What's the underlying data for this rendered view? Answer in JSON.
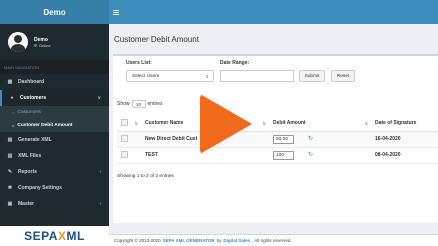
{
  "brand": {
    "title": "Demo"
  },
  "user": {
    "name": "Demo",
    "status": "Online"
  },
  "sidebar": {
    "header": "MAIN NAVIGATION",
    "items": [
      {
        "label": "Dashboard",
        "icon": "dashboard-icon"
      },
      {
        "label": "Customers",
        "icon": "users-icon"
      },
      {
        "label": "Generate XML",
        "icon": "file-icon"
      },
      {
        "label": "XML Files",
        "icon": "files-icon"
      },
      {
        "label": "Reports",
        "icon": "reports-icon"
      },
      {
        "label": "Company Settings",
        "icon": "settings-icon"
      },
      {
        "label": "Master",
        "icon": "master-icon"
      }
    ],
    "subitems": [
      {
        "label": "Customers"
      },
      {
        "label": "Customer Debit Amount"
      }
    ],
    "logo_left": "SEPA",
    "logo_x": "X",
    "logo_right": "ML"
  },
  "main": {
    "title": "Customer Debit Amount",
    "filters": {
      "users_label": "Users List:",
      "users_value": "Select Users",
      "date_label": "Date Range:",
      "submit": "Submit",
      "reset": "Reset"
    },
    "show": {
      "prefix": "Show",
      "value": "10",
      "suffix": "entries"
    },
    "table": {
      "headers": [
        "Customer Name",
        "Debit Amount",
        "Date of Signature"
      ],
      "rows": [
        {
          "name": "New Direct Debit Cust",
          "amount": "50.00",
          "date": "16-04-2020"
        },
        {
          "name": "TEST",
          "amount": "100",
          "date": "08-04-2020"
        }
      ]
    },
    "info": "Showing 1 to 2 of 2 entries"
  },
  "footer": {
    "prefix": "Copyright © 2013-2020",
    "link1": "SEPA XML GENERATOR",
    "middle": "by",
    "link2": "Digital Sales",
    "suffix": ". All rights reserved."
  },
  "colors": {
    "topbar": "#3c8dbc",
    "sidebar": "#1f2a30",
    "play": "#f26b1d"
  }
}
